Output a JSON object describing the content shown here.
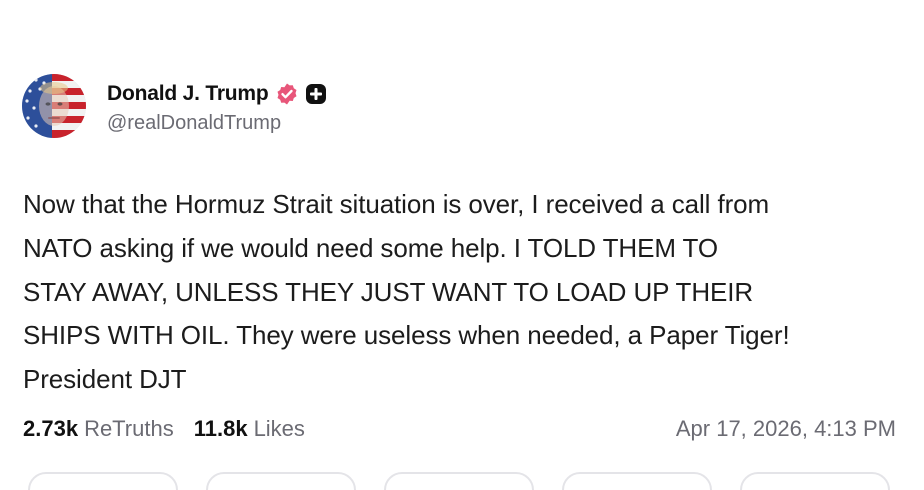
{
  "author": {
    "display_name": "Donald J. Trump",
    "handle": "@realDonaldTrump",
    "verified_icon": "verified-badge-icon",
    "verified_color": "#e8567a",
    "plus_icon": "plus-badge-icon"
  },
  "post": {
    "text": "Now that the Hormuz Strait situation is over, I received a call from\nNATO asking if we would need some help. I  TOLD THEM TO\nSTAY AWAY, UNLESS THEY JUST WANT TO LOAD UP THEIR\nSHIPS WITH OIL. They were useless when needed, a Paper Tiger!\nPresident DJT"
  },
  "stats": {
    "retruths_count": "2.73k",
    "retruths_label": "ReTruths",
    "likes_count": "11.8k",
    "likes_label": "Likes",
    "timestamp": "Apr 17, 2026, 4:13 PM"
  },
  "colors": {
    "text_primary": "#1c1c1c",
    "text_secondary": "#6b6b73",
    "pill_border": "#e4e4e8"
  }
}
